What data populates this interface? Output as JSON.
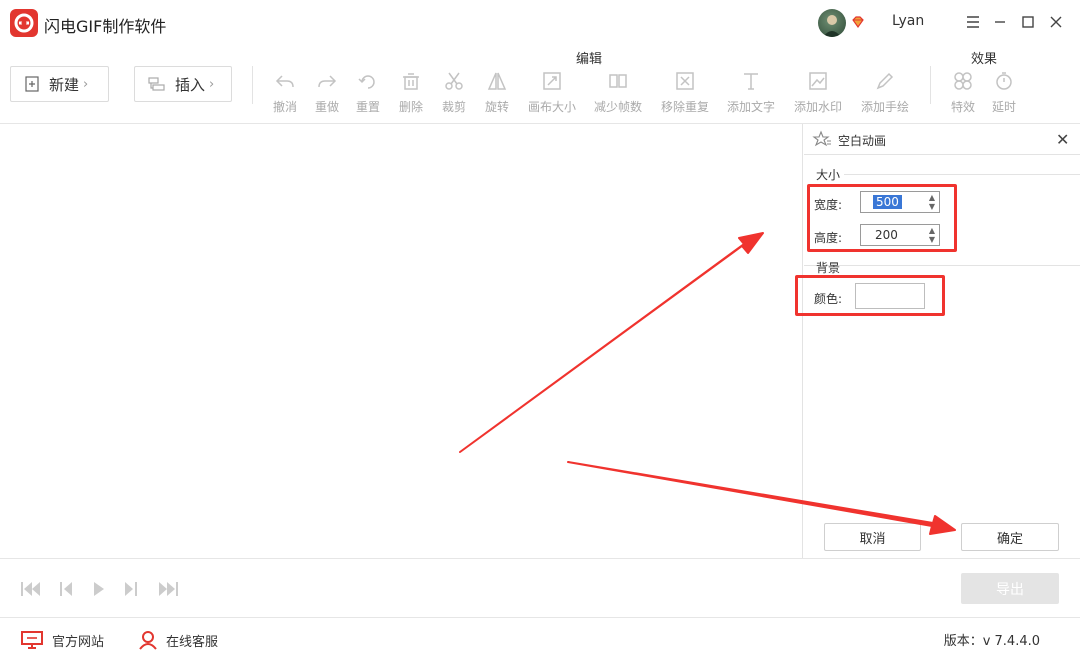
{
  "app": {
    "title": "闪电GIF制作软件",
    "username": "Lyan"
  },
  "toolbar": {
    "new_label": "新建",
    "insert_label": "插入",
    "edit_group_title": "编辑",
    "effects_group_title": "效果",
    "edit_tools": [
      {
        "label": "撤消",
        "icon": "undo-icon"
      },
      {
        "label": "重做",
        "icon": "redo-icon"
      },
      {
        "label": "重置",
        "icon": "reset-icon"
      },
      {
        "label": "删除",
        "icon": "delete-icon"
      },
      {
        "label": "裁剪",
        "icon": "scissors-icon"
      },
      {
        "label": "旋转",
        "icon": "rotate-icon"
      },
      {
        "label": "画布大小",
        "icon": "canvas-size-icon"
      },
      {
        "label": "减少帧数",
        "icon": "reduce-frames-icon"
      },
      {
        "label": "移除重复",
        "icon": "remove-duplicates-icon"
      },
      {
        "label": "添加文字",
        "icon": "text-icon"
      },
      {
        "label": "添加水印",
        "icon": "watermark-icon"
      },
      {
        "label": "添加手绘",
        "icon": "pen-icon"
      }
    ],
    "effect_tools": [
      {
        "label": "特效",
        "icon": "effects-icon"
      },
      {
        "label": "延时",
        "icon": "timer-icon"
      }
    ]
  },
  "panel": {
    "title": "空白动画",
    "size_section": "大小",
    "width_label": "宽度:",
    "width_value": "500",
    "height_label": "高度:",
    "height_value": "200",
    "background_section": "背景",
    "color_label": "颜色:",
    "color_value": "#ffffff",
    "cancel_label": "取消",
    "confirm_label": "确定"
  },
  "playbar": {
    "export_label": "导出"
  },
  "statusbar": {
    "website_label": "官方网站",
    "support_label": "在线客服",
    "version_text": "版本：v 7.4.4.0"
  },
  "colors": {
    "brand": "#e2362f",
    "highlight": "#f0332e",
    "selection": "#3a77d6"
  }
}
